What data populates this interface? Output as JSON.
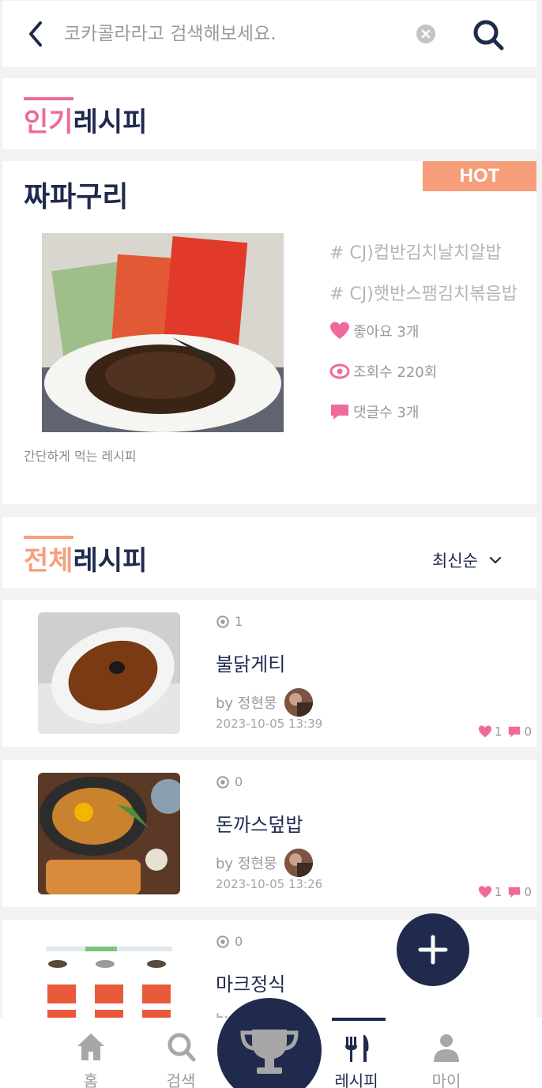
{
  "search": {
    "placeholder": "코카콜라라고 검색해보세요."
  },
  "popular": {
    "title_accent": "인기",
    "title_rest": "레시피"
  },
  "hot_recipe": {
    "badge": "HOT",
    "title": "짜파구리",
    "description": "간단하게 먹는 레시피",
    "tags": [
      "# CJ)컵반김치날치알밥",
      "# CJ)햇반스팸김치볶음밥"
    ],
    "likes": "좋아요 3개",
    "views": "조회수 220회",
    "comments": "댓글수 3개"
  },
  "all": {
    "title_accent": "전체",
    "title_rest": "레시피",
    "sort_label": "최신순"
  },
  "recipes": [
    {
      "views": "1",
      "title": "불닭게티",
      "author": "by 정현뭉",
      "date": "2023-10-05 13:39",
      "likes": "1",
      "comments": "0"
    },
    {
      "views": "0",
      "title": "돈까스덮밥",
      "author": "by 정현뭉",
      "date": "2023-10-05 13:26",
      "likes": "1",
      "comments": "0"
    },
    {
      "views": "0",
      "title": "마크정식",
      "author": "by 정현뭉",
      "date": "",
      "likes": "",
      "comments": ""
    }
  ],
  "nav": {
    "home": "홈",
    "search": "검색",
    "recipe": "레시피",
    "my": "마이"
  },
  "colors": {
    "navy": "#1f2a4d",
    "pink": "#ef6a9c",
    "orange": "#f69d7a"
  }
}
